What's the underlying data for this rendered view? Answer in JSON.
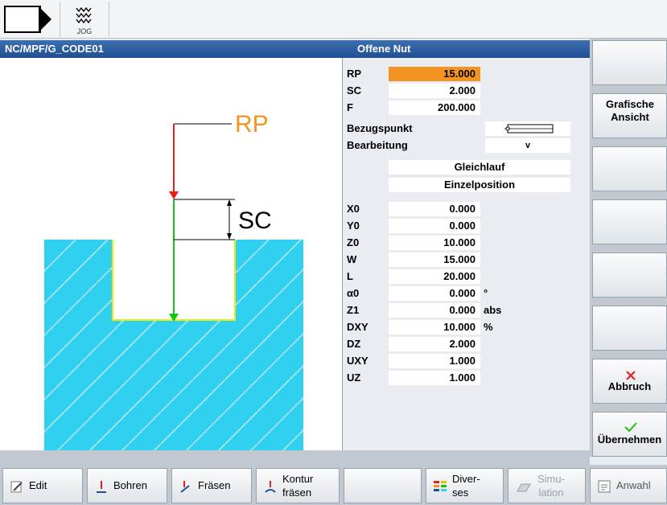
{
  "header": {
    "mode_label": "JOG"
  },
  "title": {
    "path": "NC/MPF/G_CODE01",
    "form_title": "Offene Nut"
  },
  "graphic": {
    "rp_label": "RP",
    "sc_label": "SC"
  },
  "params": {
    "rp": {
      "label": "RP",
      "value": "15.000"
    },
    "sc": {
      "label": "SC",
      "value": "2.000"
    },
    "f": {
      "label": "F",
      "value": "200.000"
    },
    "bezugspunkt": {
      "label": "Bezugspunkt"
    },
    "bearbeitung": {
      "label": "Bearbeitung",
      "value": "v"
    },
    "gleichlauf": "Gleichlauf",
    "einzelposition": "Einzelposition",
    "x0": {
      "label": "X0",
      "value": "0.000"
    },
    "y0": {
      "label": "Y0",
      "value": "0.000"
    },
    "z0": {
      "label": "Z0",
      "value": "10.000"
    },
    "w": {
      "label": "W",
      "value": "15.000"
    },
    "l": {
      "label": "L",
      "value": "20.000"
    },
    "a0": {
      "label": "α0",
      "value": "0.000",
      "unit": "°"
    },
    "z1": {
      "label": "Z1",
      "value": "0.000",
      "unit": "abs"
    },
    "dxy": {
      "label": "DXY",
      "value": "10.000",
      "unit": "%"
    },
    "dz": {
      "label": "DZ",
      "value": "2.000"
    },
    "uxy": {
      "label": "UXY",
      "value": "1.000"
    },
    "uz": {
      "label": "UZ",
      "value": "1.000"
    }
  },
  "vsoftkeys": {
    "grafische": "Grafische Ansicht",
    "abbruch": "Abbruch",
    "uebernehmen": "Übernehmen"
  },
  "hsoftkeys": {
    "edit": "Edit",
    "bohren": "Bohren",
    "fraesen": "Fräsen",
    "kontur_l1": "Kontur",
    "kontur_l2": "fräsen",
    "divers_l1": "Diver-",
    "divers_l2": "ses",
    "simu_l1": "Simu-",
    "simu_l2": "lation",
    "anwahl": "Anwahl"
  },
  "colors": {
    "title_bar": "#1f4f92",
    "active_field": "#f39422",
    "workpiece": "#2fd0f0",
    "rp_arrow": "#e52020",
    "sc_arrow": "#18c018",
    "rp_text": "#f39422"
  }
}
